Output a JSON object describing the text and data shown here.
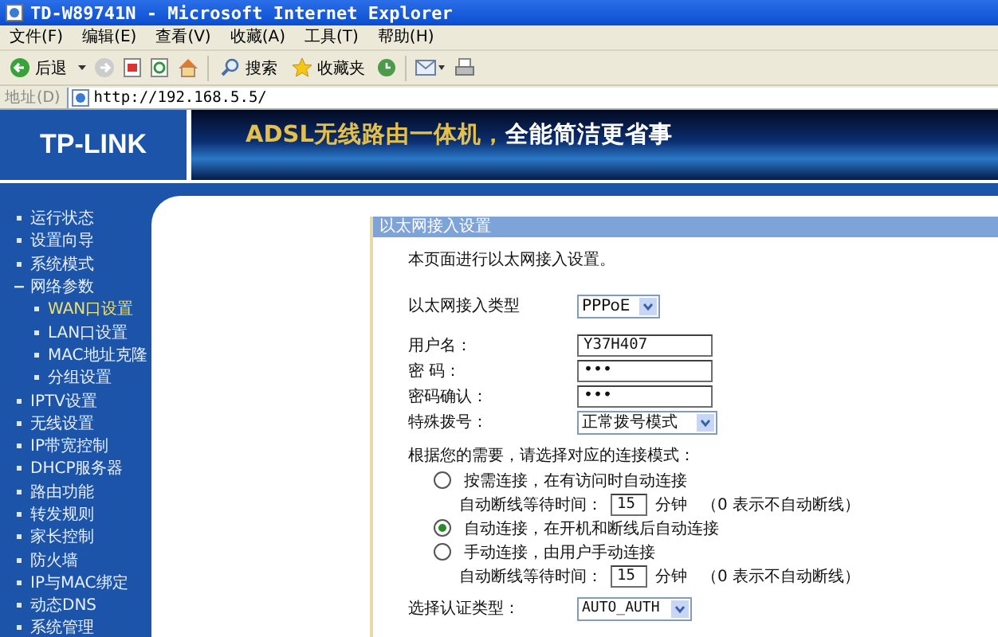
{
  "window": {
    "title": "TD-W89741N - Microsoft Internet Explorer"
  },
  "menu": [
    "文件(F)",
    "编辑(E)",
    "查看(V)",
    "收藏(A)",
    "工具(T)",
    "帮助(H)"
  ],
  "toolbar": {
    "back": "后退",
    "search": "搜索",
    "favorites": "收藏夹"
  },
  "address": {
    "label": "地址(D)",
    "url": "http://192.168.5.5/"
  },
  "banner": {
    "logo": "TP-LINK",
    "slogan_highlight": "ADSL无线路由一体机，",
    "slogan": "全能简洁更省事"
  },
  "sidebar": {
    "items": [
      {
        "label": "运行状态",
        "expanded": false,
        "selected": false
      },
      {
        "label": "设置向导",
        "expanded": false,
        "selected": false
      },
      {
        "label": "系统模式",
        "expanded": false,
        "selected": false
      },
      {
        "label": "网络参数",
        "expanded": true,
        "selected": false,
        "children": [
          {
            "label": "WAN口设置",
            "selected": true
          },
          {
            "label": "LAN口设置",
            "selected": false
          },
          {
            "label": "MAC地址克隆",
            "selected": false
          },
          {
            "label": "分组设置",
            "selected": false
          }
        ]
      },
      {
        "label": "IPTV设置",
        "expanded": false,
        "selected": false
      },
      {
        "label": "无线设置",
        "expanded": false,
        "selected": false
      },
      {
        "label": "IP带宽控制",
        "expanded": false,
        "selected": false
      },
      {
        "label": "DHCP服务器",
        "expanded": false,
        "selected": false
      },
      {
        "label": "路由功能",
        "expanded": false,
        "selected": false
      },
      {
        "label": "转发规则",
        "expanded": false,
        "selected": false
      },
      {
        "label": "家长控制",
        "expanded": false,
        "selected": false
      },
      {
        "label": "防火墙",
        "expanded": false,
        "selected": false
      },
      {
        "label": "IP与MAC绑定",
        "expanded": false,
        "selected": false
      },
      {
        "label": "动态DNS",
        "expanded": false,
        "selected": false
      },
      {
        "label": "系统管理",
        "expanded": false,
        "selected": false
      }
    ]
  },
  "panel": {
    "title": "以太网接入设置",
    "intro": "本页面进行以太网接入设置。",
    "type_field": {
      "label": "以太网接入类型",
      "value": "PPPoE"
    },
    "fields": [
      {
        "kind": "text",
        "label": "用户名：",
        "value": "Y37H407"
      },
      {
        "kind": "password",
        "label": "密 码：",
        "value": "•••"
      },
      {
        "kind": "password",
        "label": "密码确认：",
        "value": "•••"
      },
      {
        "kind": "select",
        "label": "特殊拨号：",
        "value": "正常拨号模式"
      }
    ],
    "mode_prompt": "根据您的需要，请选择对应的连接模式：",
    "modes": [
      {
        "label": "按需连接，在有访问时自动连接",
        "selected": false,
        "timeout": {
          "label": "自动断线等待时间：",
          "value": "15",
          "unit": "分钟",
          "note": "（0 表示不自动断线）"
        }
      },
      {
        "label": "自动连接，在开机和断线后自动连接",
        "selected": true
      },
      {
        "label": "手动连接，由用户手动连接",
        "selected": false,
        "timeout": {
          "label": "自动断线等待时间：",
          "value": "15",
          "unit": "分钟",
          "note": "（0 表示不自动断线）"
        }
      }
    ],
    "auth": {
      "label": "选择认证类型：",
      "value": "AUTO_AUTH"
    }
  }
}
